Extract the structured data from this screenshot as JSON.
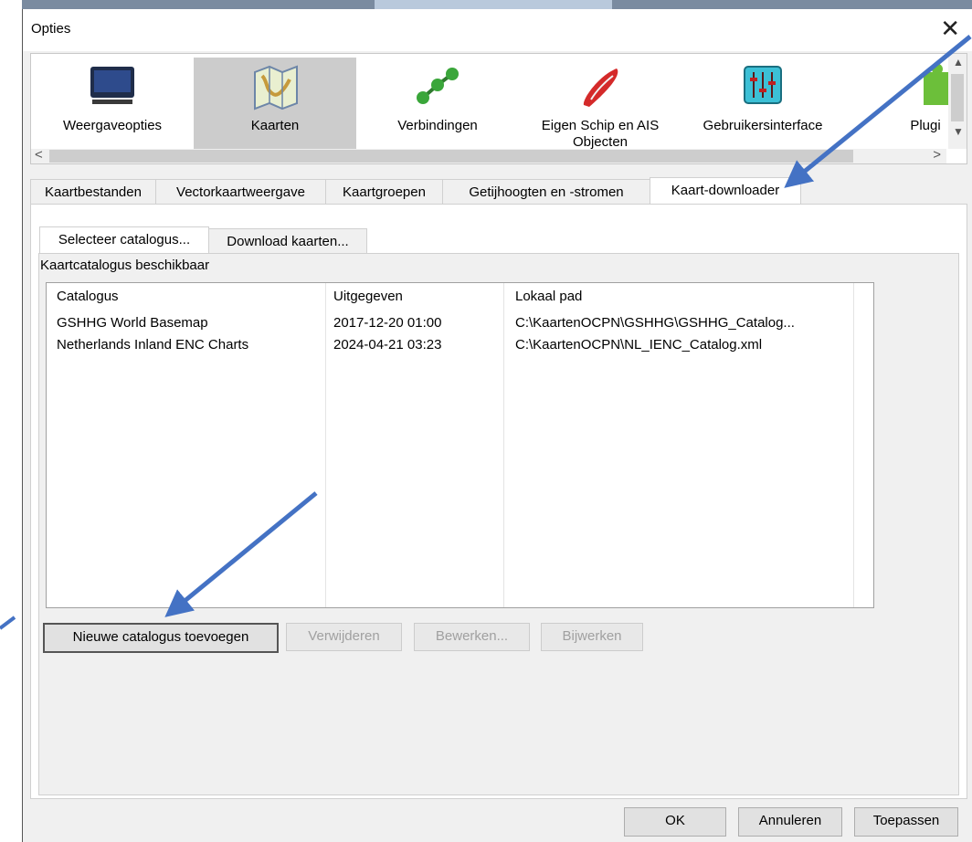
{
  "window": {
    "title": "Opties"
  },
  "toolbar": {
    "items": [
      {
        "label": "Weergaveopties",
        "icon": "monitor-icon"
      },
      {
        "label": "Kaarten",
        "icon": "map-icon"
      },
      {
        "label": "Verbindingen",
        "icon": "connections-icon"
      },
      {
        "label": "Eigen Schip en AIS Objecten",
        "icon": "ship-icon"
      },
      {
        "label": "Gebruikersinterface",
        "icon": "sliders-icon"
      },
      {
        "label": "Plugi",
        "icon": "puzzle-icon"
      }
    ],
    "selected": "Kaarten"
  },
  "tabs": [
    "Kaartbestanden",
    "Vectorkaartweergave",
    "Kaartgroepen",
    "Getijhoogten en -stromen",
    "Kaart-downloader"
  ],
  "active_tab": "Kaart-downloader",
  "subtabs": [
    "Selecteer catalogus...",
    "Download kaarten..."
  ],
  "active_subtab": "Selecteer catalogus...",
  "section_label": "Kaartcatalogus beschikbaar",
  "catalog_table": {
    "headers": [
      "Catalogus",
      "Uitgegeven",
      "Lokaal pad"
    ],
    "rows": [
      [
        "GSHHG World Basemap",
        "2017-12-20 01:00",
        "C:\\KaartenOCPN\\GSHHG\\GSHHG_Catalog..."
      ],
      [
        "Netherlands Inland ENC Charts",
        "2024-04-21 03:23",
        "C:\\KaartenOCPN\\NL_IENC_Catalog.xml"
      ]
    ]
  },
  "catalog_buttons": {
    "add": "Nieuwe catalogus toevoegen",
    "remove": "Verwijderen",
    "edit": "Bewerken...",
    "update": "Bijwerken"
  },
  "dialog_buttons": {
    "ok": "OK",
    "cancel": "Annuleren",
    "apply": "Toepassen"
  },
  "colors": {
    "annotation_arrow": "#4472c4",
    "selected_tool": "#cccccc"
  }
}
